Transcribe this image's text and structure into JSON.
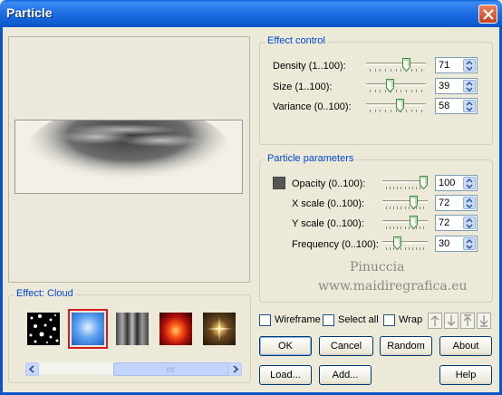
{
  "window": {
    "title": "Particle"
  },
  "effect_control": {
    "legend": "Effect control",
    "rows": [
      {
        "label": "Density (1..100):",
        "value": "71",
        "level": 0.71
      },
      {
        "label": "Size (1..100):",
        "value": "39",
        "level": 0.39
      },
      {
        "label": "Variance (0..100):",
        "value": "58",
        "level": 0.58
      }
    ]
  },
  "particle_parameters": {
    "legend": "Particle parameters",
    "swatch_color": "#555555",
    "rows": [
      {
        "label": "Opacity (0..100):",
        "value": "100",
        "level": 1.0
      },
      {
        "label": "X scale (0..100):",
        "value": "72",
        "level": 0.72
      },
      {
        "label": "Y scale (0..100):",
        "value": "72",
        "level": 0.72
      },
      {
        "label": "Frequency (0..100):",
        "value": "30",
        "level": 0.3
      }
    ]
  },
  "watermark": {
    "line1": "Pinuccia",
    "line2": "www.maidiregrafica.eu"
  },
  "effect_panel": {
    "legend": "Effect: Cloud"
  },
  "options": {
    "wireframe": "Wireframe",
    "select_all": "Select all",
    "wrap": "Wrap"
  },
  "buttons": {
    "ok": "OK",
    "cancel": "Cancel",
    "random": "Random",
    "about": "About",
    "load": "Load...",
    "add": "Add...",
    "help": "Help"
  },
  "colors": {
    "title_bar": "#0a55c8",
    "accent_label": "#0046d5",
    "selected_effect_border": "#d51d1d"
  }
}
